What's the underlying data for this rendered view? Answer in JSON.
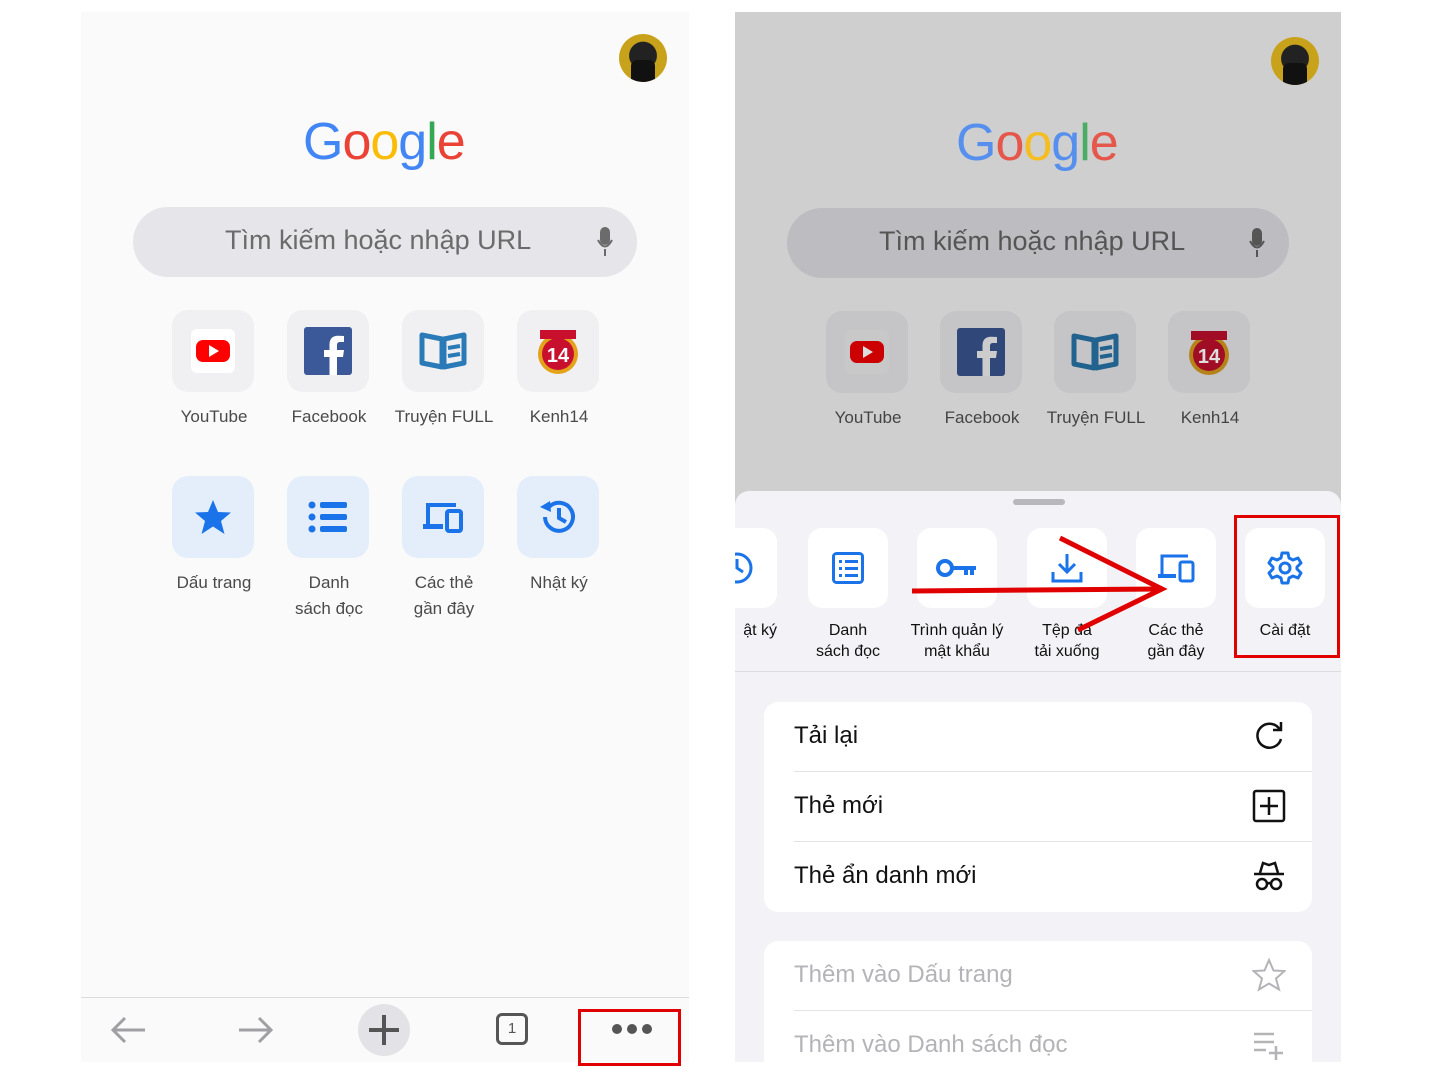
{
  "left_screen": {
    "logo": {
      "letters": [
        "G",
        "o",
        "o",
        "g",
        "l",
        "e"
      ]
    },
    "search": {
      "placeholder": "Tìm kiếm hoặc nhập URL"
    },
    "shortcuts": [
      {
        "label": "YouTube",
        "icon": "youtube-icon"
      },
      {
        "label": "Facebook",
        "icon": "facebook-icon"
      },
      {
        "label": "Truyện FULL",
        "icon": "book-icon"
      },
      {
        "label": "Kenh14",
        "icon": "kenh14-icon"
      }
    ],
    "actions": [
      {
        "line1": "Dấu trang",
        "line2": "",
        "icon": "star-icon"
      },
      {
        "line1": "Danh",
        "line2": "sách đọc",
        "icon": "list-icon"
      },
      {
        "line1": "Các thẻ",
        "line2": "gần đây",
        "icon": "devices-icon"
      },
      {
        "line1": "Nhật ký",
        "line2": "",
        "icon": "history-icon"
      }
    ],
    "toolbar": {
      "tab_count": "1"
    }
  },
  "right_screen": {
    "logo": {
      "letters": [
        "G",
        "o",
        "o",
        "g",
        "l",
        "e"
      ]
    },
    "search": {
      "placeholder": "Tìm kiếm hoặc nhập URL"
    },
    "shortcuts": [
      {
        "label": "YouTube"
      },
      {
        "label": "Facebook"
      },
      {
        "label": "Truyện FULL"
      },
      {
        "label": "Kenh14"
      }
    ],
    "quick_actions": [
      {
        "line1": "ật ký",
        "line2": "",
        "icon": "history-icon"
      },
      {
        "line1": "Danh",
        "line2": "sách đọc",
        "icon": "list-icon"
      },
      {
        "line1": "Trình quản lý",
        "line2": "mật khẩu",
        "icon": "key-icon"
      },
      {
        "line1": "Tệp đã",
        "line2": "tải xuống",
        "icon": "download-icon"
      },
      {
        "line1": "Các thẻ",
        "line2": "gần đây",
        "icon": "devices-icon"
      },
      {
        "line1": "Cài đặt",
        "line2": "",
        "icon": "gear-icon"
      }
    ],
    "menu_group1": [
      {
        "label": "Tải lại",
        "icon": "reload-icon"
      },
      {
        "label": "Thẻ mới",
        "icon": "new-tab-icon"
      },
      {
        "label": "Thẻ ẩn danh mới",
        "icon": "incognito-icon"
      }
    ],
    "menu_group2": [
      {
        "label": "Thêm vào Dấu trang",
        "icon": "star-outline-icon"
      },
      {
        "label": "Thêm vào Danh sách đọc",
        "icon": "add-list-icon"
      }
    ]
  },
  "colors": {
    "google_blue": "#4285F4",
    "google_red": "#EA4335",
    "google_yellow": "#FBBC05",
    "google_green": "#34A853",
    "chrome_blue": "#1a73e8",
    "highlight_red": "#e00000"
  }
}
